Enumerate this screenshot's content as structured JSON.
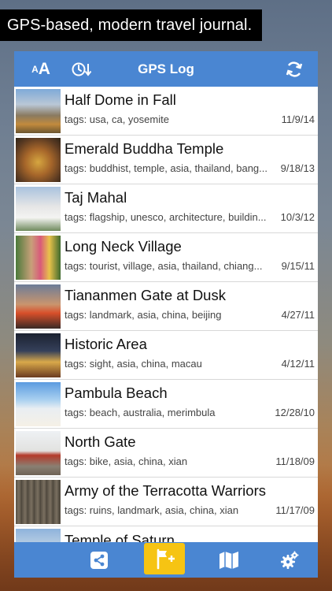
{
  "banner": "GPS-based, modern travel journal.",
  "navbar": {
    "title": "GPS Log",
    "font_small": "A",
    "font_big": "A"
  },
  "entries": [
    {
      "title": "Half Dome in Fall",
      "tags": "tags: usa, ca, yosemite",
      "date": "11/9/14"
    },
    {
      "title": "Emerald Buddha Temple",
      "tags": "tags: buddhist, temple, asia, thailand, bang...",
      "date": "9/18/13"
    },
    {
      "title": "Taj Mahal",
      "tags": "tags: flagship, unesco, architecture, buildin...",
      "date": "10/3/12"
    },
    {
      "title": "Long Neck Village",
      "tags": "tags: tourist, village, asia, thailand, chiang...",
      "date": "9/15/11"
    },
    {
      "title": "Tiananmen Gate at Dusk",
      "tags": "tags: landmark, asia, china, beijing",
      "date": "4/27/11"
    },
    {
      "title": "Historic Area",
      "tags": "tags: sight, asia, china, macau",
      "date": "4/12/11"
    },
    {
      "title": "Pambula Beach",
      "tags": "tags: beach, australia, merimbula",
      "date": "12/28/10"
    },
    {
      "title": "North Gate",
      "tags": "tags: bike, asia, china, xian",
      "date": "11/18/09"
    },
    {
      "title": "Army of the Terracotta Warriors",
      "tags": "tags: ruins, landmark, asia, china, xian",
      "date": "11/17/09"
    },
    {
      "title": "Temple of Saturn",
      "tags": "",
      "date": ""
    }
  ],
  "colors": {
    "bar": "#4a86d2",
    "add_button": "#f6c413"
  },
  "icons": {
    "sort": "clock-sort-icon",
    "refresh": "refresh-icon",
    "share": "share-icon",
    "add": "add-flag-icon",
    "map": "map-icon",
    "settings": "gear-icon"
  }
}
